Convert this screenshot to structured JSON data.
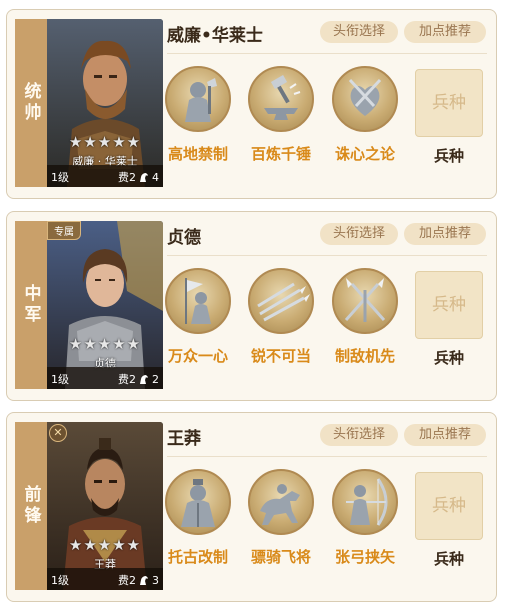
{
  "buttons": {
    "title_select": "头衔选择",
    "point_recommend": "加点推荐"
  },
  "troop_label": "兵种",
  "star_text": "★★★★★",
  "cards": [
    {
      "role": "统帅",
      "name": "威廉•华莱士",
      "portrait_name": "威廉 · 华莱士",
      "level": "1级",
      "cost": "费2",
      "horse_count": "4",
      "tag": "",
      "skills": [
        {
          "name": "高地禁制",
          "icon": "knight-axe-icon"
        },
        {
          "name": "百炼千锤",
          "icon": "anvil-hammer-icon"
        },
        {
          "name": "诛心之论",
          "icon": "heart-swords-icon"
        }
      ],
      "troop_box": "兵种"
    },
    {
      "role": "中军",
      "name": "贞德",
      "portrait_name": "贞德",
      "level": "1级",
      "cost": "费2",
      "horse_count": "2",
      "tag": "专属",
      "skills": [
        {
          "name": "万众一心",
          "icon": "banner-maiden-icon"
        },
        {
          "name": "锐不可当",
          "icon": "spear-rush-icon"
        },
        {
          "name": "制敌机先",
          "icon": "crossed-spears-icon"
        }
      ],
      "troop_box": "兵种"
    },
    {
      "role": "前锋",
      "name": "王莽",
      "portrait_name": "王莽",
      "level": "1级",
      "cost": "费2",
      "horse_count": "3",
      "tag": "",
      "skills": [
        {
          "name": "托古改制",
          "icon": "official-robe-icon"
        },
        {
          "name": "骠骑飞将",
          "icon": "charging-horse-icon"
        },
        {
          "name": "张弓挟矢",
          "icon": "archer-bow-icon"
        }
      ],
      "troop_box": "兵种"
    }
  ],
  "colors": {
    "accent": "#c9a06a",
    "skill_text": "#d98a1a",
    "button_bg": "#f1e2c6"
  }
}
